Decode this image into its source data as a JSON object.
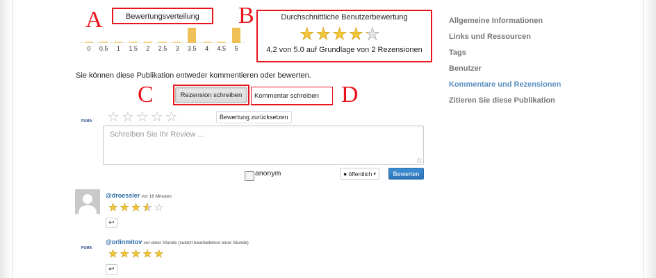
{
  "annotations": {
    "a": "A",
    "b": "B",
    "c": "C",
    "d": "D"
  },
  "rating_distribution": {
    "title": "Bewertungsverteilung",
    "chart_data": {
      "type": "bar",
      "categories": [
        "0",
        "0.5",
        "1",
        "1.5",
        "2",
        "2.5",
        "3",
        "3.5",
        "4",
        "4.5",
        "5"
      ],
      "values": [
        0,
        0,
        0,
        0,
        0,
        0,
        0,
        1,
        0,
        0,
        1
      ],
      "title": "Bewertungsverteilung",
      "xlabel": "",
      "ylabel": "",
      "bar_color": "#f0c058"
    }
  },
  "average": {
    "title": "Durchschnittliche Benutzerbewertung",
    "rating": 4.2,
    "max": 5,
    "text": "4,2 von 5.0 auf Grundlage von 2 Rezensionen"
  },
  "prompt": "Sie können diese Publikation entweder kommentieren oder bewerten.",
  "buttons": {
    "rezension": "Rezension schreiben",
    "kommentar": "Kommentar schreiben",
    "reset": "Bewertung zurücksetzen",
    "visibility": "öffentlich",
    "submit": "Bewerten"
  },
  "logo_text": "PUMA",
  "review": {
    "placeholder": "Schreiben Sie Ihr Review ...",
    "anon_label": "anonym"
  },
  "reviews": [
    {
      "user": "@droessler",
      "meta": "vor 16 Minuten",
      "rating": 3.5
    },
    {
      "user": "@orlinmitov",
      "meta": "vor einer Stunde (zuletzt bearbeitetvor einer Stunde)",
      "rating": 5
    }
  ],
  "sidebar": {
    "items": [
      {
        "label": "Allgemeine Informationen",
        "active": false
      },
      {
        "label": "Links und Ressourcen",
        "active": false
      },
      {
        "label": "Tags",
        "active": false
      },
      {
        "label": "Benutzer",
        "active": false
      },
      {
        "label": "Kommentare und Rezensionen",
        "active": true
      },
      {
        "label": "Zitieren Sie diese Publikation",
        "active": false
      }
    ]
  },
  "colors": {
    "accent": "#e8141c",
    "link": "#2d6ca8",
    "primary_button": "#2b73b6",
    "star": "#f3c63b"
  }
}
